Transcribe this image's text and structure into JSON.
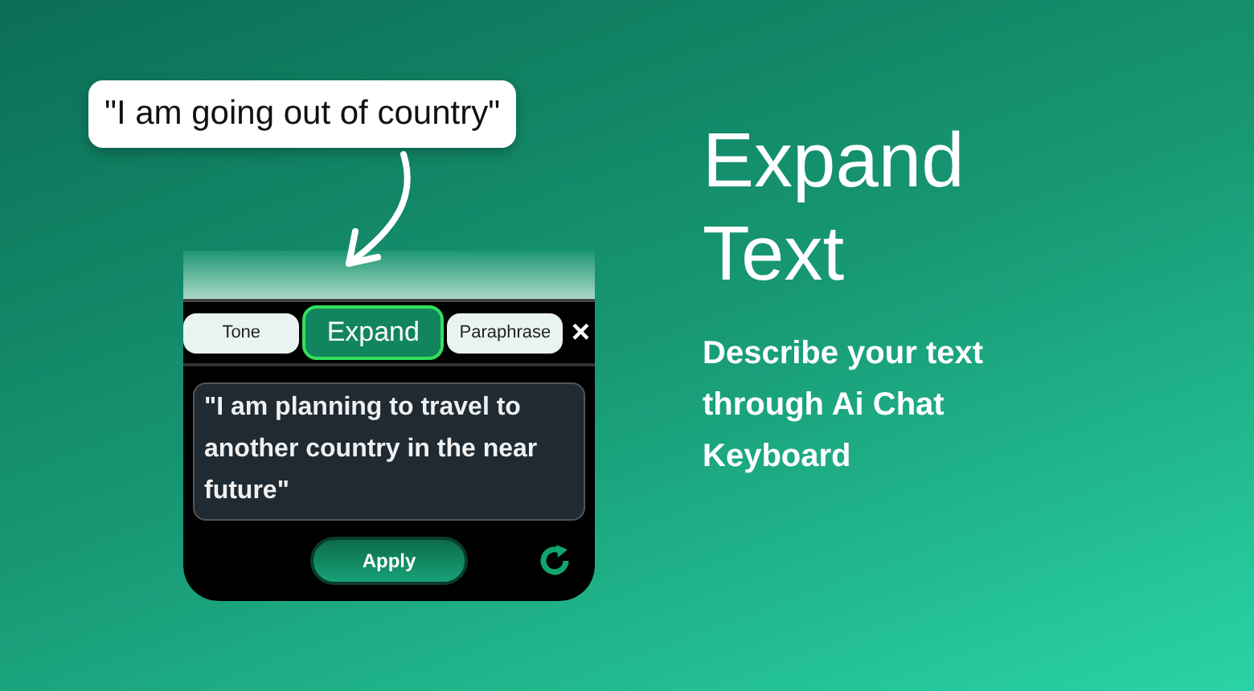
{
  "callout": {
    "text": "\"I am going out of country\""
  },
  "panel": {
    "tabs": [
      {
        "label": "Tone",
        "selected": false
      },
      {
        "label": "Expand",
        "selected": true
      },
      {
        "label": "Paraphrase",
        "selected": false
      }
    ],
    "close": "×",
    "result": "\"I am planning to travel to another country in the near future\"",
    "apply": "Apply"
  },
  "headline": [
    "Expand",
    "Text"
  ],
  "subtitle": "Describe your text through Ai Chat Keyboard"
}
